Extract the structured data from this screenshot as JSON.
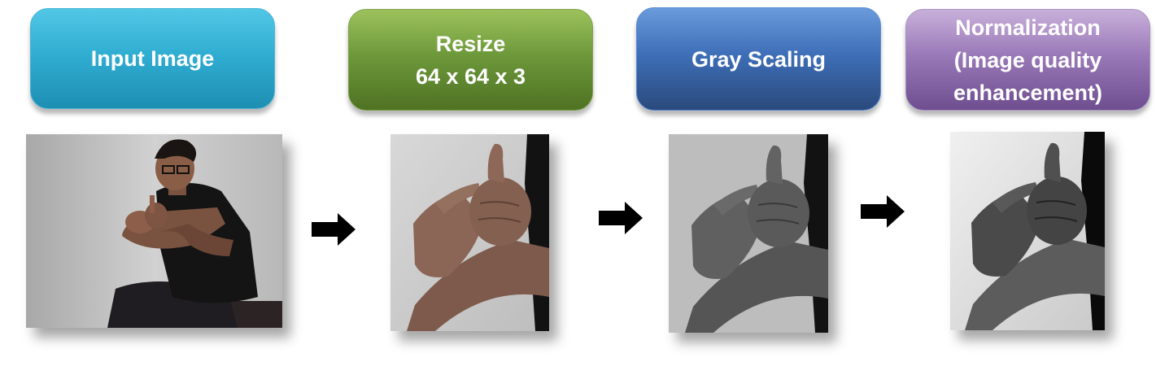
{
  "stages": [
    {
      "id": "input",
      "lines": [
        "Input Image"
      ]
    },
    {
      "id": "resize",
      "lines": [
        "Resize",
        "64 x 64 x 3"
      ]
    },
    {
      "id": "gray",
      "lines": [
        "Gray Scaling"
      ]
    },
    {
      "id": "norm",
      "lines": [
        "Normalization",
        "(Image quality",
        "enhancement)"
      ]
    }
  ],
  "colors": {
    "input": "#30aed2",
    "resize": "#6e993b",
    "gray": "#3e6fb8",
    "norm": "#9a79b8",
    "arrow": "#000000"
  },
  "images": [
    {
      "stage": "input",
      "description_icon": "person-hand-sign-photo"
    },
    {
      "stage": "resize",
      "description_icon": "hand-sign-color-crop"
    },
    {
      "stage": "gray",
      "description_icon": "hand-sign-grayscale"
    },
    {
      "stage": "norm",
      "description_icon": "hand-sign-normalized"
    }
  ],
  "arrows": [
    "right-arrow-icon",
    "right-arrow-icon",
    "right-arrow-icon"
  ]
}
